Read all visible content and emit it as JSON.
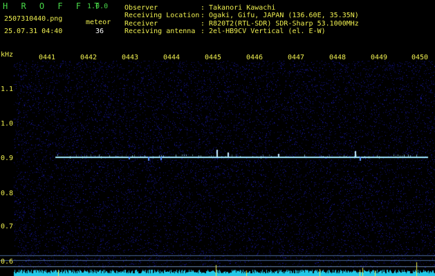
{
  "header": {
    "brand_name": "H R O F F T",
    "brand_version": "1.0.0",
    "filename": "2507310440.png",
    "datetime": "25.07.31 04:40",
    "counter_label": "meteor",
    "counter_value": "36",
    "info": [
      {
        "key": "Observer",
        "value": ": Takanori Kawachi"
      },
      {
        "key": "Receiving Location",
        "value": ": Ogaki, Gifu, JAPAN (136.60E, 35.35N)"
      },
      {
        "key": "Receiver",
        "value": ": R820T2(RTL-SDR) SDR-Sharp 53.1000MHz"
      },
      {
        "key": "Receiving antenna",
        "value": ": 2el-HB9CV Vertical (el. E-W)"
      }
    ]
  },
  "axis": {
    "unit_label": "kHz",
    "x_ticks": [
      "0441",
      "0442",
      "0443",
      "0444",
      "0445",
      "0446",
      "0447",
      "0448",
      "0449",
      "0450"
    ],
    "y_ticks": [
      "1.1",
      "1.0",
      "0.9",
      "0.8",
      "0.7",
      "0.6"
    ]
  },
  "colors": {
    "background": "#000000",
    "noise": "#1a1a8c",
    "carrier": "#9fe8ff",
    "text_label": "#f0f050",
    "brand": "#48d848",
    "bottom_strip": "#22c8e8",
    "spike": "#f0f050"
  }
}
